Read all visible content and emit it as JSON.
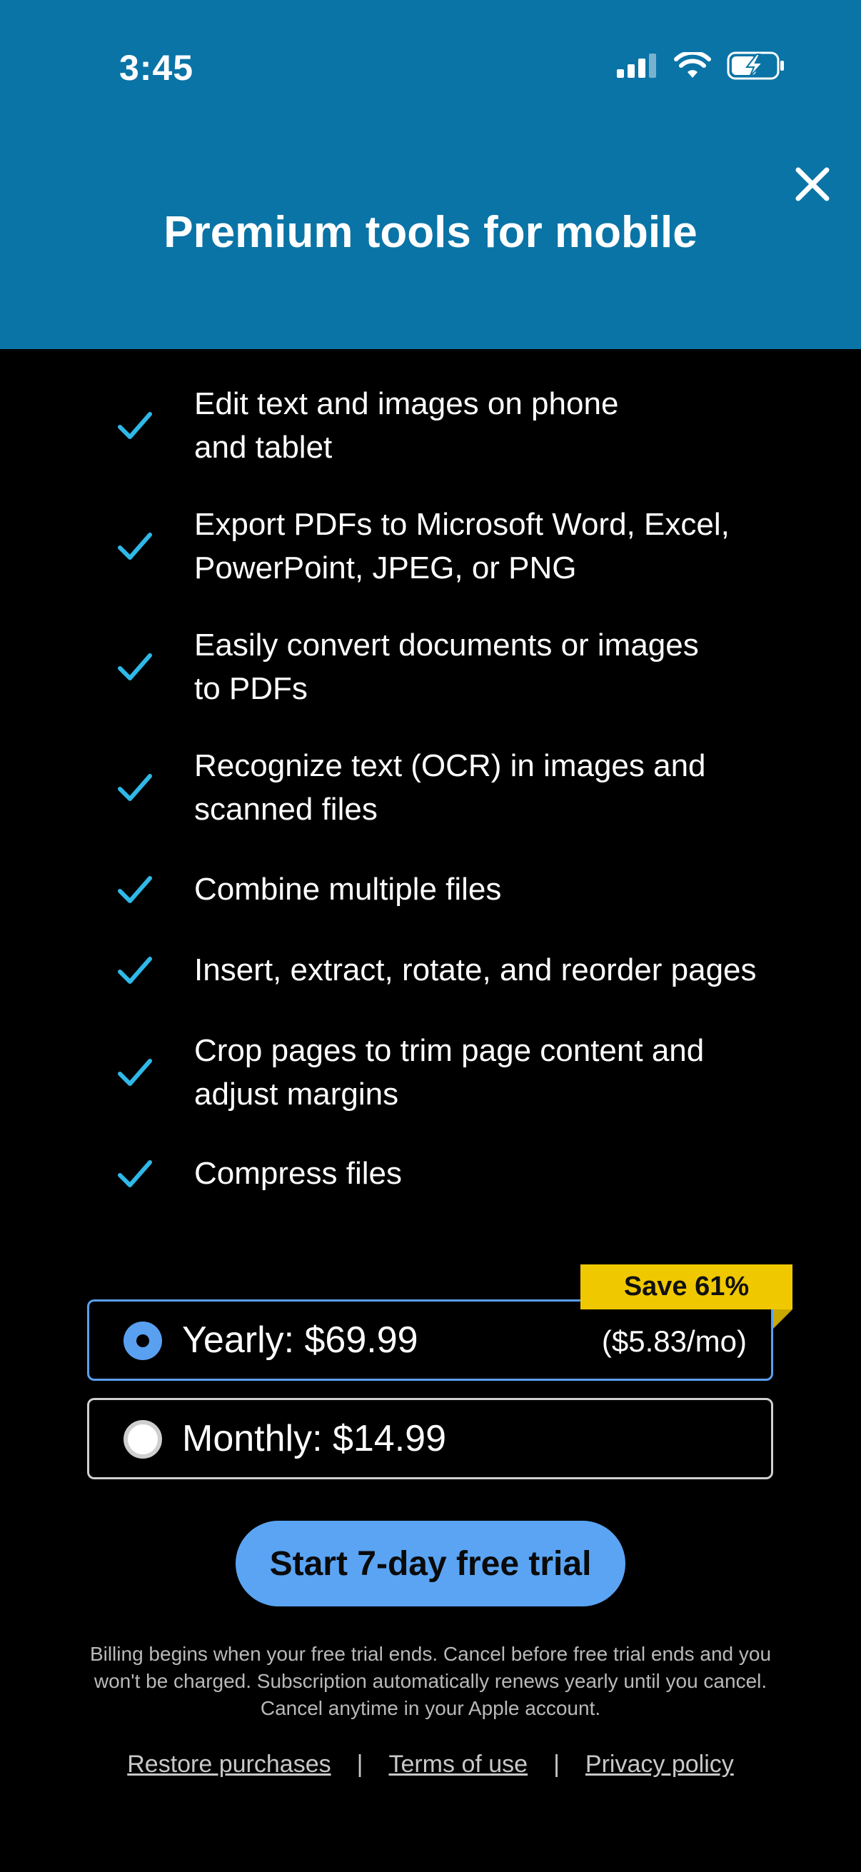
{
  "status_bar": {
    "time": "3:45",
    "icons": [
      "signal-icon",
      "wifi-icon",
      "battery-charging-icon"
    ]
  },
  "header": {
    "title": "Premium tools for mobile",
    "close_icon": "close-icon",
    "background": "#0a74a6"
  },
  "features": [
    {
      "line1": "Edit text and images on phone",
      "line2": "and tablet"
    },
    {
      "line1": "Export PDFs to Microsoft Word, Excel,",
      "line2": "PowerPoint, JPEG, or PNG"
    },
    {
      "line1": "Easily convert documents or images",
      "line2": "to PDFs"
    },
    {
      "line1": "Recognize text (OCR) in images and",
      "line2": "scanned files"
    },
    {
      "line1": "Combine multiple files",
      "line2": ""
    },
    {
      "line1": "Insert, extract, rotate, and reorder pages",
      "line2": ""
    },
    {
      "line1": "Crop pages to trim page content and",
      "line2": "adjust margins"
    },
    {
      "line1": "Compress files",
      "line2": ""
    }
  ],
  "plans": {
    "badge": "Save 61%",
    "yearly": {
      "label": "Yearly: $69.99",
      "sub": "($5.83/mo)",
      "selected": true
    },
    "monthly": {
      "label": "Monthly: $14.99",
      "selected": false
    }
  },
  "cta_label": "Start 7-day free trial",
  "legal": {
    "line1": "Billing begins when your free trial ends. Cancel before free trial ends and you",
    "line2": "won't be charged. Subscription automatically renews yearly until you cancel.",
    "line3": "Cancel anytime in your Apple account."
  },
  "links": {
    "restore": "Restore purchases",
    "terms": "Terms of use",
    "privacy": "Privacy policy",
    "separator": "|"
  },
  "colors": {
    "accent": "#5aa4f3",
    "check": "#2fb8e8",
    "badge": "#f0c800"
  }
}
